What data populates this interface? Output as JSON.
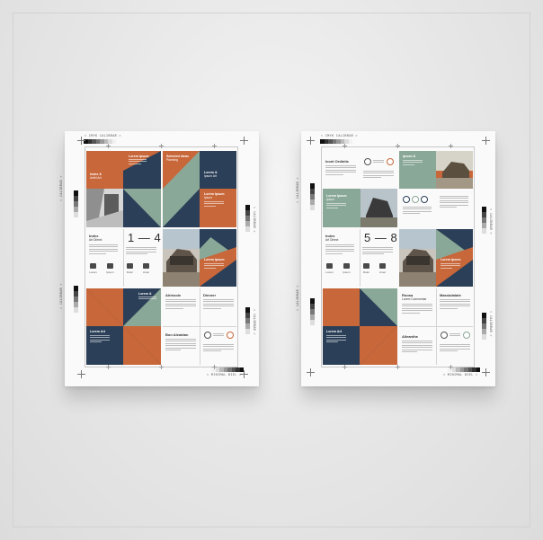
{
  "colors": {
    "orange": "#c8673a",
    "navy": "#2b3f58",
    "sage": "#8aa897",
    "paper": "#fafafa"
  },
  "sheets": {
    "left": {
      "top_label": "< CMYK CALIBRAR >",
      "side_left_upper": "< CALIBRAR >",
      "side_left_lower": "< CALIBRAR >",
      "side_right_upper": "< CALIBRAR >",
      "side_right_lower": "< CALIBRAR >",
      "bottom_label": "< MINIMAL BIEL >",
      "page_range": "1 — 4",
      "block_title": "Index",
      "block_subtitle": "Art Diirect",
      "p1_title": "Index &",
      "p1_sub": "Antlrt Art",
      "p2_title": "Lorem Ipsum",
      "p2_lines": "Lorem",
      "p3_title": "Selected Ideas",
      "p3_sub": "Planning",
      "p4_title": "Lorem &",
      "p4_sub": "Ipsum Art",
      "p5_title": "Lorem Ipsum",
      "p5_sub": "Ipsum",
      "p6_title": "Lorem Ipsum",
      "p7_title": "Lorem &",
      "p8_title": "Lorem Art",
      "p9_title": "Kitchen Art",
      "p10_title": "Alrinsole",
      "p11_title": "Dinnerr",
      "p12_title": "Lorem Ipsum",
      "p13_title": "Bon Aleaidan",
      "icons_row": [
        "Lorem",
        "Ipsum",
        "Dolor",
        "Amet"
      ]
    },
    "right": {
      "top_label": "< CMYK CALIBRAR >",
      "side_left_upper": "< CALIBRAR >",
      "side_left_lower": "< CALIBRAR >",
      "side_right_upper": "< CALIBRAR >",
      "side_right_lower": "< CALIBRAR >",
      "bottom_label": "< MINIMAL BIEL >",
      "page_range": "5 — 8",
      "block_title": "Index",
      "block_subtitle": "Art Diirect",
      "p1_title": "Icont Ordinitc",
      "p2_title": "Lorem Ipsum",
      "p2_sub": "Ipsum",
      "p3_title": "Ipsum &",
      "p4_title": "Lorem Ipsum",
      "p5_title": "Lorem Art",
      "p6_title": "Lorem &",
      "p7_title": "Lorem Ipsum",
      "p8_title": "Roosa",
      "p8_sub": "Lorem Commentar",
      "p9_title": "Masskdalate",
      "p10_title": "Lorem Ipsum",
      "p11_title": "Alleanthe",
      "icons_row": [
        "Lorem",
        "Ipsum",
        "Dolor",
        "Amet"
      ]
    }
  }
}
